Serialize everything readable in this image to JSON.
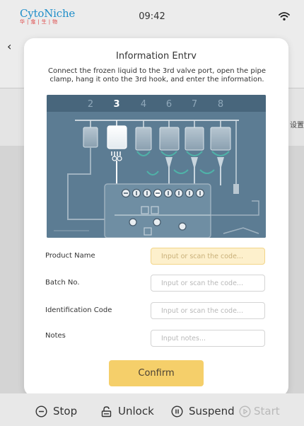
{
  "status_bar": {
    "logo_text_left": "Cyto",
    "logo_text_right": "Niche",
    "logo_sub": "华|龛|生|物",
    "time": "09:42"
  },
  "background": {
    "side_text": "设置"
  },
  "modal": {
    "title": "Information Entrv",
    "description": "Connect the frozen liquid to the 3rd valve port, open the pipe clamp, hang it onto the 3rd hook, and enter the information.",
    "diagram": {
      "port_numbers": [
        "2",
        "3",
        "4",
        "6",
        "7",
        "8"
      ],
      "highlighted_port": "3"
    },
    "fields": [
      {
        "label": "Product Name",
        "placeholder": "Input or scan the code...",
        "value": ""
      },
      {
        "label": "Batch No.",
        "placeholder": "Input or scan the code...",
        "value": ""
      },
      {
        "label": "Identification Code",
        "placeholder": "Input or scan the code...",
        "value": ""
      },
      {
        "label": "Notes",
        "placeholder": "Input notes...",
        "value": ""
      }
    ],
    "confirm_label": "Confirm"
  },
  "toolbar": {
    "stop_label": "Stop",
    "unlock_label": "Unlock",
    "suspend_label": "Suspend",
    "start_label": "Start"
  },
  "colors": {
    "accent": "#f5cf6a",
    "active_input_bg": "#fdf0cc",
    "diagram_bg": "#5c7c93",
    "logo_blue": "#1f8ec9",
    "logo_red": "#d44444"
  }
}
